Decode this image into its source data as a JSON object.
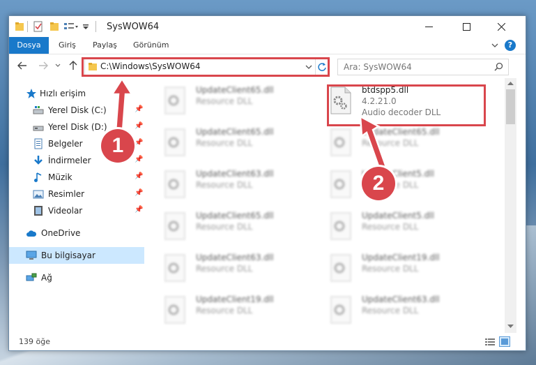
{
  "window": {
    "title": "SysWOW64"
  },
  "ribbon": {
    "tabs": [
      "Dosya",
      "Giriş",
      "Paylaş",
      "Görünüm"
    ]
  },
  "address": {
    "path": "C:\\Windows\\SysWOW64"
  },
  "search": {
    "placeholder": "Ara: SysWOW64"
  },
  "sidebar": {
    "items": [
      {
        "label": "Hızlı erişim",
        "icon": "star-icon"
      },
      {
        "label": "Yerel Disk (C:)",
        "icon": "drive-icon",
        "pinned": true
      },
      {
        "label": "Yerel Disk (D:)",
        "icon": "drive-icon",
        "pinned": true
      },
      {
        "label": "Belgeler",
        "icon": "documents-icon",
        "pinned": true
      },
      {
        "label": "İndirmeler",
        "icon": "downloads-icon",
        "pinned": true
      },
      {
        "label": "Müzik",
        "icon": "music-icon",
        "pinned": true
      },
      {
        "label": "Resimler",
        "icon": "pictures-icon",
        "pinned": true
      },
      {
        "label": "Videolar",
        "icon": "videos-icon",
        "pinned": true
      },
      {
        "label": "OneDrive",
        "icon": "cloud-icon"
      },
      {
        "label": "Bu bilgisayar",
        "icon": "computer-icon",
        "selected": true
      },
      {
        "label": "Ağ",
        "icon": "network-icon"
      }
    ]
  },
  "files": {
    "left": [
      {
        "name": "UpdateClient65.dll",
        "type": "Resource DLL"
      },
      {
        "name": "UpdateClient65.dll",
        "type": "Resource DLL"
      },
      {
        "name": "UpdateClient63.dll",
        "type": "Resource DLL"
      },
      {
        "name": "UpdateClient65.dll",
        "type": "Resource DLL"
      },
      {
        "name": "UpdateClient63.dll",
        "type": "Resource DLL"
      },
      {
        "name": "UpdateClient19.dll",
        "type": "Resource DLL"
      }
    ],
    "right": [
      {
        "name": "btdspp5.dll",
        "version": "4.2.21.0",
        "type": "Audio decoder DLL",
        "highlighted": true
      },
      {
        "name": "UpdateClient65.dll",
        "type": "Resource DLL"
      },
      {
        "name": "UpdateClient5.dll",
        "type": "Resource DLL"
      },
      {
        "name": "UpdateClient5.dll",
        "type": "Resource DLL"
      },
      {
        "name": "UpdateClient19.dll",
        "type": "Resource DLL"
      },
      {
        "name": "UpdateClient63.dll",
        "type": "Resource DLL"
      }
    ]
  },
  "status": {
    "count": "139 öğe"
  },
  "annotations": {
    "step1": "1",
    "step2": "2",
    "color": "#d9464c"
  }
}
